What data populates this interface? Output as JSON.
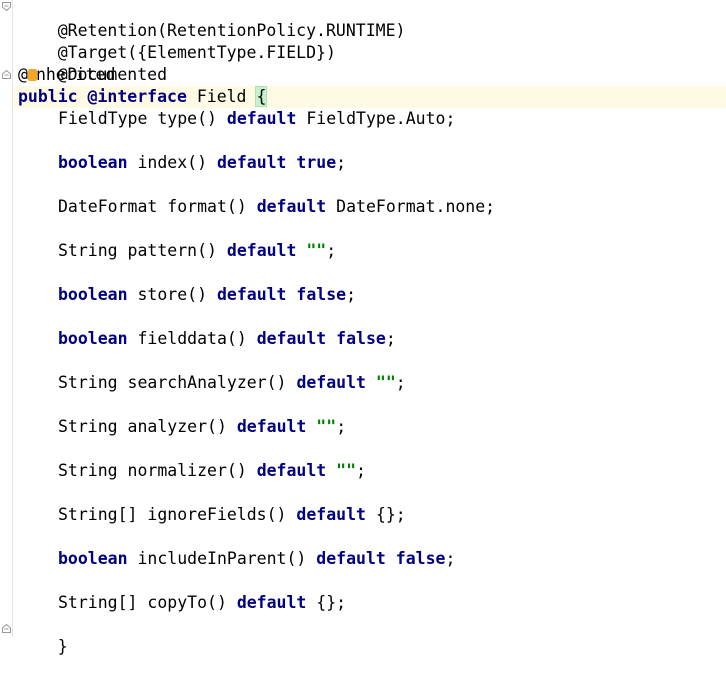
{
  "code": {
    "annotations": {
      "retention": "@Retention(RetentionPolicy.RUNTIME)",
      "target": "@Target({ElementType.FIELD})",
      "documented": "@Documented",
      "inherited_prefix": "@",
      "inherited_rest": "nherited",
      "inherited_hidden_char": "I"
    },
    "decl": {
      "public": "public",
      "interface_kw": "@interface",
      "name": " Field ",
      "open_brace": "{"
    },
    "members": [
      {
        "pre": "FieldType ",
        "method": "type() ",
        "default": "default",
        "value": " FieldType.Auto;",
        "value_kind": "plain",
        "type_kw": false
      },
      {
        "pre": "boolean",
        "method": " index() ",
        "default": "default",
        "value": " true",
        "tail": ";",
        "value_kind": "kw",
        "type_kw": true
      },
      {
        "pre": "DateFormat ",
        "method": "format() ",
        "default": "default",
        "value": " DateFormat.none;",
        "value_kind": "plain",
        "type_kw": false
      },
      {
        "pre": "String ",
        "method": "pattern() ",
        "default": "default",
        "value": " \"\"",
        "tail": ";",
        "value_kind": "str",
        "type_kw": false
      },
      {
        "pre": "boolean",
        "method": " store() ",
        "default": "default",
        "value": " false",
        "tail": ";",
        "value_kind": "kw",
        "type_kw": true
      },
      {
        "pre": "boolean",
        "method": " fielddata() ",
        "default": "default",
        "value": " false",
        "tail": ";",
        "value_kind": "kw",
        "type_kw": true
      },
      {
        "pre": "String ",
        "method": "searchAnalyzer() ",
        "default": "default",
        "value": " \"\"",
        "tail": ";",
        "value_kind": "str",
        "type_kw": false
      },
      {
        "pre": "String ",
        "method": "analyzer() ",
        "default": "default",
        "value": " \"\"",
        "tail": ";",
        "value_kind": "str",
        "type_kw": false
      },
      {
        "pre": "String ",
        "method": "normalizer() ",
        "default": "default",
        "value": " \"\"",
        "tail": ";",
        "value_kind": "str",
        "type_kw": false
      },
      {
        "pre": "String[] ",
        "method": "ignoreFields() ",
        "default": "default",
        "value": " {};",
        "value_kind": "plain",
        "type_kw": false
      },
      {
        "pre": "boolean",
        "method": " includeInParent() ",
        "default": "default",
        "value": " false",
        "tail": ";",
        "value_kind": "kw",
        "type_kw": true
      },
      {
        "pre": "String[] ",
        "method": "copyTo() ",
        "default": "default",
        "value": " {};",
        "value_kind": "plain",
        "type_kw": false
      }
    ],
    "close_brace": "}"
  },
  "colors": {
    "keyword": "#000080",
    "string": "#008000",
    "current_line": "#fffae3",
    "intention_bulb": "#f5a623"
  },
  "icons": {
    "fold_top": "fold-collapse-icon",
    "intention": "lightbulb-icon",
    "fold_bottom": "fold-end-icon"
  }
}
